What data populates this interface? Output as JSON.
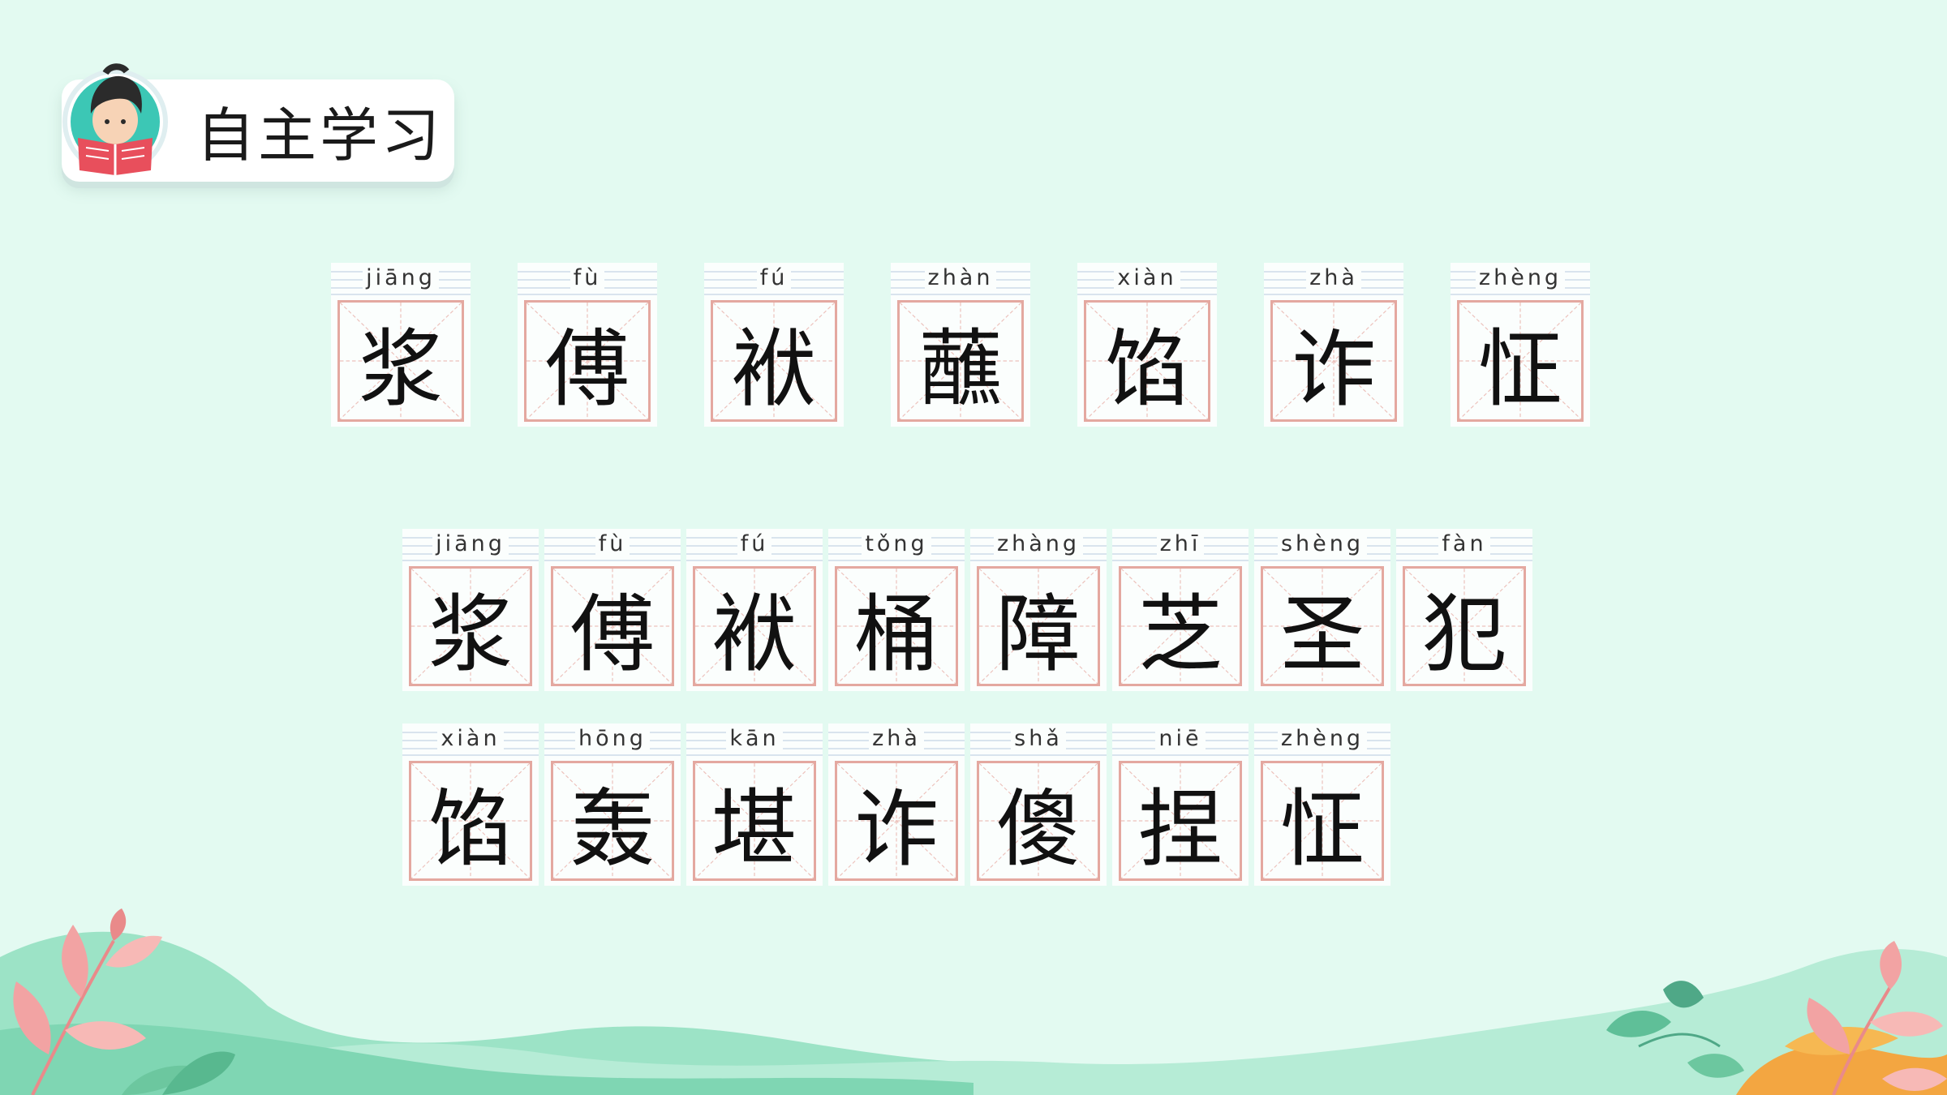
{
  "title": "自主学习",
  "row1": [
    {
      "py": "jiāng",
      "hz": "浆"
    },
    {
      "py": "fù",
      "hz": "傅"
    },
    {
      "py": "fú",
      "hz": "袱"
    },
    {
      "py": "zhàn",
      "hz": "蘸"
    },
    {
      "py": "xiàn",
      "hz": "馅"
    },
    {
      "py": "zhà",
      "hz": "诈"
    },
    {
      "py": "zhèng",
      "hz": "怔"
    }
  ],
  "row2": [
    {
      "py": "jiāng",
      "hz": "浆"
    },
    {
      "py": "fù",
      "hz": "傅"
    },
    {
      "py": "fú",
      "hz": "袱"
    },
    {
      "py": "tǒng",
      "hz": "桶"
    },
    {
      "py": "zhàng",
      "hz": "障"
    },
    {
      "py": "zhī",
      "hz": "芝"
    },
    {
      "py": "shèng",
      "hz": "圣"
    },
    {
      "py": "fàn",
      "hz": "犯"
    }
  ],
  "row3": [
    {
      "py": "xiàn",
      "hz": "馅"
    },
    {
      "py": "hōng",
      "hz": "轰"
    },
    {
      "py": "kān",
      "hz": "堪"
    },
    {
      "py": "zhà",
      "hz": "诈"
    },
    {
      "py": "shǎ",
      "hz": "傻"
    },
    {
      "py": "niē",
      "hz": "捏"
    },
    {
      "py": "zhèng",
      "hz": "怔"
    }
  ]
}
